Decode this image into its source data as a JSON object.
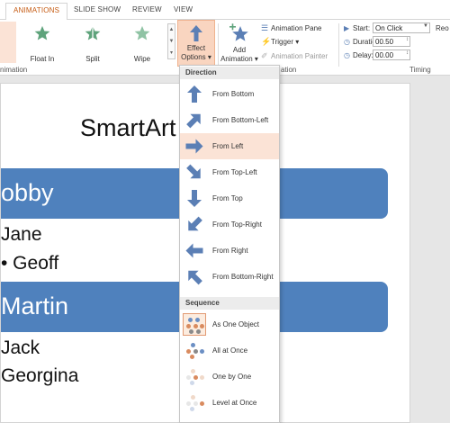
{
  "ribbon_tabs": [
    "ANIMATIONS",
    "SLIDE SHOW",
    "REVIEW",
    "VIEW"
  ],
  "animations_gallery": [
    {
      "label": "Float In",
      "icon": "star-float-in-icon"
    },
    {
      "label": "Split",
      "icon": "star-split-icon"
    },
    {
      "label": "Wipe",
      "icon": "star-wipe-icon"
    }
  ],
  "effect_options": {
    "line1": "Effect",
    "line2": "Options ▾"
  },
  "add_animation": {
    "line1": "Add",
    "line2": "Animation ▾"
  },
  "advanced": {
    "animation_pane": "Animation Pane",
    "trigger": "Trigger ▾",
    "animation_painter": "Animation Painter"
  },
  "timing": {
    "start_label": "Start:",
    "start_value": "On Click",
    "duration_label": "Duration:",
    "duration_value": "00.50",
    "delay_label": "Delay:",
    "delay_value": "00.00",
    "reorder_partial": "Reo"
  },
  "group_labels": {
    "animation_left": "nimation",
    "advanced": "ation",
    "timing": "Timing"
  },
  "slide": {
    "title": "SmartArt",
    "bar1": "obby",
    "bar1_items": [
      "Jane",
      "• Geoff"
    ],
    "bar2": "Martin",
    "bar2_items": [
      "Jack",
      "Georgina"
    ]
  },
  "dropdown": {
    "direction_header": "Direction",
    "direction_items": [
      {
        "label": "From Bottom",
        "icon": "arrow-up-icon"
      },
      {
        "label": "From Bottom-Left",
        "icon": "arrow-up-right-icon"
      },
      {
        "label": "From Left",
        "icon": "arrow-right-icon"
      },
      {
        "label": "From Top-Left",
        "icon": "arrow-down-right-icon"
      },
      {
        "label": "From Top",
        "icon": "arrow-down-icon"
      },
      {
        "label": "From Top-Right",
        "icon": "arrow-down-left-icon"
      },
      {
        "label": "From Right",
        "icon": "arrow-left-icon"
      },
      {
        "label": "From Bottom-Right",
        "icon": "arrow-up-left-icon"
      }
    ],
    "selected_direction": "From Left",
    "sequence_header": "Sequence",
    "sequence_items": [
      {
        "label": "As One Object",
        "icon": "as-one-object-icon"
      },
      {
        "label": "All at Once",
        "icon": "all-at-once-icon"
      },
      {
        "label": "One by One",
        "icon": "one-by-one-icon"
      },
      {
        "label": "Level at Once",
        "icon": "level-at-once-icon"
      }
    ],
    "selected_sequence": "As One Object"
  },
  "colors": {
    "accent": "#c55a11",
    "selected_fill": "#fbe3d6",
    "arrow_blue": "#5b7fb5",
    "slide_bar": "#4f81bd",
    "star_green": "#5ea37b"
  }
}
